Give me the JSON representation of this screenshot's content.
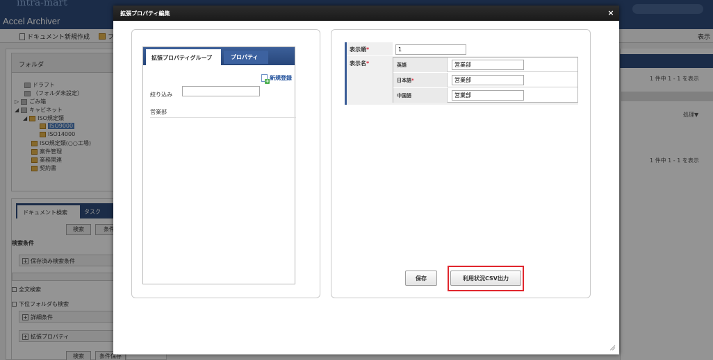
{
  "background": {
    "logo_text": "intra-mart",
    "app_title": "Accel Archiver",
    "toolbar": {
      "new_document": "ドキュメント新規作成",
      "folder_cut": "フ",
      "display": "表示"
    },
    "folder_panel": {
      "title": "フォルダ",
      "items": [
        "ドラフト",
        "（フォルダ未設定）",
        "ごみ箱",
        "キャビネット",
        "ISO規定類",
        "ISO9000",
        "ISO14000",
        "ISO規定類(○○工場)",
        "案件管理",
        "業務関連",
        "契約書"
      ]
    },
    "search_panel": {
      "tab_document_search": "ドキュメント検索",
      "tab_task": "タスク",
      "search_button": "検索",
      "condition_button": "条件",
      "conditions_title": "検索条件",
      "saved_conditions": "保存済み検索条件",
      "fulltext_search": "全文検索",
      "subfolder_search": "下位フォルダも検索",
      "detail_conditions": "詳細条件",
      "extended_properties": "拡張プロパティ",
      "search_button_bottom": "検索",
      "condition_save_button": "条件保存"
    },
    "right_panel": {
      "count_top": "1 件中 1 - 1 を表示",
      "process": "処理▼",
      "count_bottom": "1 件中 1 - 1 を表示"
    }
  },
  "dialog": {
    "title": "拡張プロパティ編集",
    "close_symbol": "×",
    "left": {
      "tab_group": "拡張プロパティグループ",
      "tab_property": "プロパティ",
      "new_register": "新規登録",
      "filter_label": "絞り込み",
      "filter_value": "",
      "group_items": [
        "営業部"
      ]
    },
    "form": {
      "order_label": "表示順",
      "order_value": "1",
      "name_label": "表示名",
      "required_mark": "*",
      "languages": [
        {
          "name": "英語",
          "required": false,
          "value": "営業部"
        },
        {
          "name": "日本語",
          "required": true,
          "value": "営業部"
        },
        {
          "name": "中国語",
          "required": false,
          "value": "営業部"
        }
      ],
      "save_button": "保存",
      "csv_button": "利用状況CSV出力"
    }
  },
  "colors": {
    "titlebar": "#1f1f1f",
    "tab_blue": "#2f4f86",
    "accent_border": "#3b5d97",
    "required": "#d9263a",
    "highlight": "#e0262d"
  }
}
